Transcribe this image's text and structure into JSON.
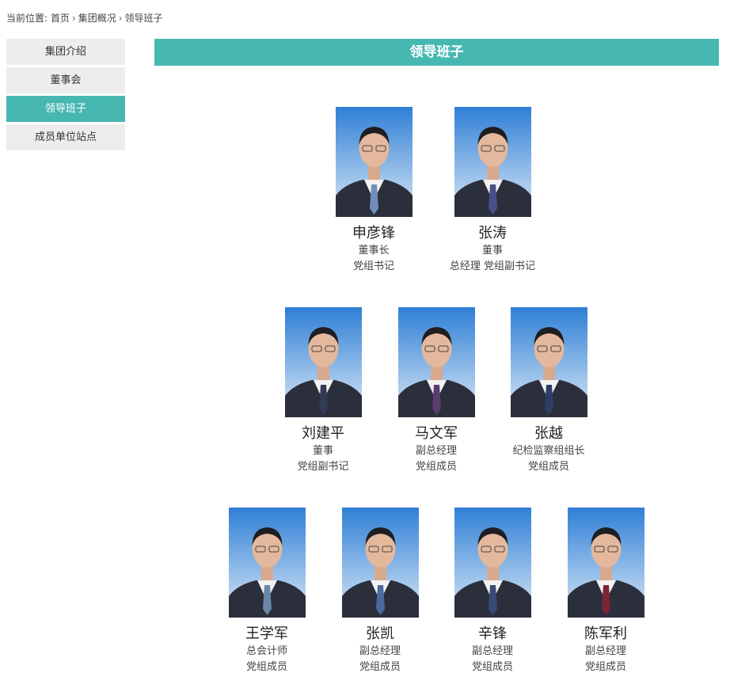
{
  "breadcrumb": {
    "prefix": "当前位置:",
    "items": [
      "首页",
      "集团概况",
      "领导班子"
    ],
    "separator": "›"
  },
  "sidebar": {
    "items": [
      {
        "label": "集团介绍",
        "active": false
      },
      {
        "label": "董事会",
        "active": false
      },
      {
        "label": "领导班子",
        "active": true
      },
      {
        "label": "成员单位站点",
        "active": false
      }
    ]
  },
  "banner": {
    "title": "领导班子"
  },
  "colors": {
    "accent": "#47b8b1",
    "sidebar_bg": "#ededed",
    "photo_bg_top": "#2f7fd6",
    "photo_bg_bottom": "#dbe9f6"
  },
  "people": [
    {
      "name": "申彦锋",
      "roles": [
        "董事长",
        "党组书记"
      ],
      "tie": "#6f8fb8"
    },
    {
      "name": "张涛",
      "roles": [
        "董事",
        "总经理 党组副书记"
      ],
      "tie": "#4a4f8a"
    },
    {
      "name": "刘建平",
      "roles": [
        "董事",
        "党组副书记"
      ],
      "tie": "#333a55"
    },
    {
      "name": "马文军",
      "roles": [
        "副总经理",
        "党组成员"
      ],
      "tie": "#5a3c6e"
    },
    {
      "name": "张越",
      "roles": [
        "纪检监察组组长",
        "党组成员"
      ],
      "tie": "#2d3d66"
    },
    {
      "name": "王学军",
      "roles": [
        "总会计师",
        "党组成员"
      ],
      "tie": "#6a86a8"
    },
    {
      "name": "张凯",
      "roles": [
        "副总经理",
        "党组成员"
      ],
      "tie": "#4b6aa0"
    },
    {
      "name": "辛锋",
      "roles": [
        "副总经理",
        "党组成员"
      ],
      "tie": "#3a4a78"
    },
    {
      "name": "陈军利",
      "roles": [
        "副总经理",
        "党组成员"
      ],
      "tie": "#7a2436"
    }
  ]
}
